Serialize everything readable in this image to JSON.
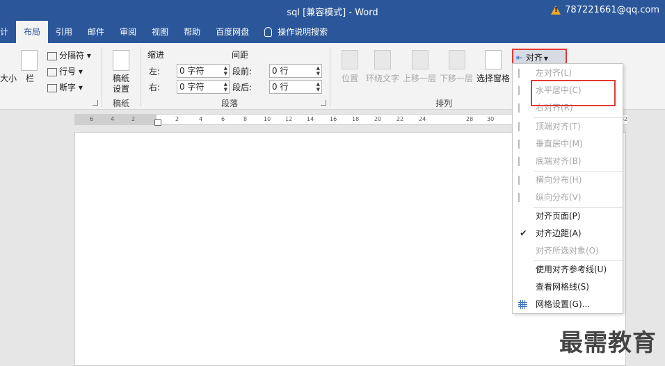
{
  "window": {
    "title": "sql [兼容模式]  -  Word",
    "account": "787221661@qq.com"
  },
  "tabs": [
    {
      "label": "计"
    },
    {
      "label": "布局"
    },
    {
      "label": "引用"
    },
    {
      "label": "邮件"
    },
    {
      "label": "审阅"
    },
    {
      "label": "视图"
    },
    {
      "label": "帮助"
    },
    {
      "label": "百度网盘"
    },
    {
      "label": "操作说明搜索"
    }
  ],
  "ribbon": {
    "size": "大小",
    "columns": "栏",
    "breaks": "分隔符",
    "line_numbers": "行号",
    "hyphenation": "断字",
    "draft_paper_l1": "稿纸",
    "draft_paper_l2": "设置",
    "draft_group": "稿纸",
    "indent_title": "缩进",
    "spacing_title": "间距",
    "indent_left_label": "左:",
    "indent_left_value": "0 字符",
    "indent_right_label": "右:",
    "indent_right_value": "0 字符",
    "spacing_before_label": "段前:",
    "spacing_before_value": "0 行",
    "spacing_after_label": "段后:",
    "spacing_after_value": "0 行",
    "paragraph_group": "段落",
    "position": "位置",
    "wrap_text": "环绕文字",
    "bring_forward": "上移一层",
    "send_backward": "下移一层",
    "selection_pane": "选择窗格",
    "arrange_group": "排列",
    "align_button": "对齐"
  },
  "ruler_ticks": [
    "6",
    "4",
    "2",
    "2",
    "4",
    "6",
    "8",
    "10",
    "12",
    "14",
    "16",
    "18",
    "20",
    "22",
    "24",
    "28",
    "30",
    "32"
  ],
  "align_menu": [
    {
      "label": "左对齐(L)",
      "enabled": false,
      "icon": "align-left-icon"
    },
    {
      "label": "水平居中(C)",
      "enabled": false,
      "icon": "align-center-icon"
    },
    {
      "label": "右对齐(R)",
      "enabled": false,
      "icon": "align-right-icon"
    },
    {
      "label": "顶端对齐(T)",
      "enabled": false,
      "icon": "align-top-icon"
    },
    {
      "label": "垂直居中(M)",
      "enabled": false,
      "icon": "align-middle-icon"
    },
    {
      "label": "底端对齐(B)",
      "enabled": false,
      "icon": "align-bottom-icon"
    },
    {
      "label": "横向分布(H)",
      "enabled": false,
      "icon": "distribute-horizontal-icon"
    },
    {
      "label": "纵向分布(V)",
      "enabled": false,
      "icon": "distribute-vertical-icon"
    },
    {
      "label": "对齐页面(P)",
      "enabled": true
    },
    {
      "label": "对齐边距(A)",
      "enabled": true,
      "checked": true
    },
    {
      "label": "对齐所选对象(O)",
      "enabled": false
    },
    {
      "label": "使用对齐参考线(U)",
      "enabled": true
    },
    {
      "label": "查看网格线(S)",
      "enabled": true
    },
    {
      "label": "网格设置(G)...",
      "enabled": true,
      "icon": "grid-icon"
    }
  ],
  "watermark": "最需教育",
  "colors": {
    "titlebar": "#2b579a",
    "highlight": "#e53935"
  }
}
